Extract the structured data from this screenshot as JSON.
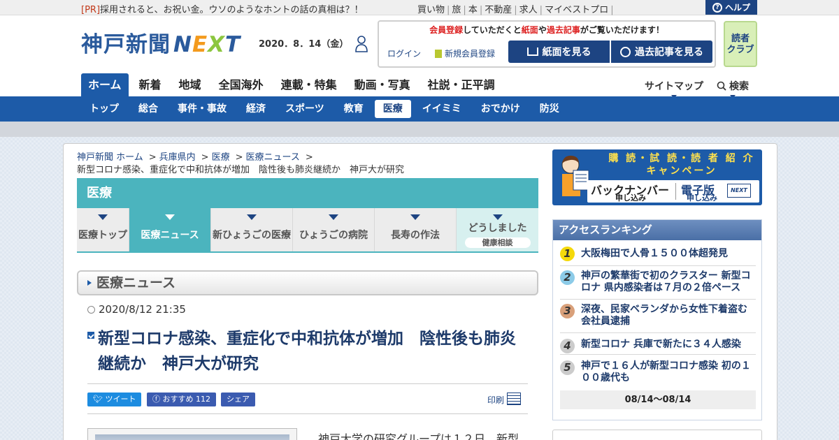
{
  "topbar": {
    "pr_tag": "[PR]",
    "pr_text": "採用されると、お祝い金。ウソのようなホントの話の真相は？！",
    "util_links": [
      "買い物",
      "旅",
      "本",
      "不動産",
      "求人",
      "マイベストプロ"
    ],
    "help_label": "ヘルプ"
  },
  "header": {
    "logo_text": "神戸新聞",
    "logo_next": [
      "N",
      "E",
      "X",
      "T"
    ],
    "date": "2020．8．14（金）",
    "member_msg": {
      "p1": "会員登録",
      "p2": "していただくと",
      "p3": "紙面",
      "p4": "や",
      "p5": "過去記事",
      "p6": "がご覧いただけます！"
    },
    "login_label": "ログイン",
    "register_label": "新規会員登録",
    "view_paper_label": "紙面を見る",
    "past_articles_label": "過去記事を見る",
    "club_line1": "読者",
    "club_line2": "クラブ"
  },
  "main_nav": [
    "ホーム",
    "新着",
    "地域",
    "全国海外",
    "連載・特集",
    "動画・写真",
    "社説・正平調"
  ],
  "right_nav": {
    "sitemap": "サイトマップ",
    "search": "検索"
  },
  "sub_nav": [
    "トップ",
    "総合",
    "事件・事故",
    "経済",
    "スポーツ",
    "教育",
    "医療",
    "イイミミ",
    "おでかけ",
    "防災"
  ],
  "breadcrumb": {
    "items": [
      "神戸新聞 ホーム",
      "兵庫県内",
      "医療",
      "医療ニュース"
    ],
    "current": "新型コロナ感染、重症化で中和抗体が増加　陰性後も肺炎継続か　神戸大が研究"
  },
  "section": {
    "title": "医療",
    "tabs": [
      "医療トップ",
      "医療ニュース",
      "新ひょうごの医療",
      "ひょうごの病院",
      "長寿の作法",
      "どうしました"
    ],
    "tab_pill": "健康相談",
    "news_header": "医療ニュース"
  },
  "article": {
    "datetime": "2020/8/12 21:35",
    "title": "新型コロナ感染、重症化で中和抗体が増加　陰性後も肺炎継続か　神戸大が研究",
    "tweet_label": "ツイート",
    "recommend_label": "おすすめ",
    "recommend_count": "112",
    "share_label": "シェア",
    "print_label": "印刷",
    "lead": "神戸大学の研究グループは１２日、新型"
  },
  "sidebar": {
    "banner": {
      "line1": "購 読・試 読・読 者 紹 介",
      "line2": "キャンペーン",
      "backnumber": "バックナンバー",
      "backnumber_sub": "申し込み",
      "eedition": "電子版",
      "eedition_sub": "申し込み",
      "next_badge": "NEXT"
    },
    "ranking": {
      "title": "アクセスランキング",
      "items": [
        {
          "rank": "1",
          "title": "大阪梅田で人骨１５００体超発見"
        },
        {
          "rank": "2",
          "title": "神戸の繁華街で初のクラスター 新型コロナ 県内感染者は７月の２倍ペース"
        },
        {
          "rank": "3",
          "title": "深夜、民家ベランダから女性下着盗む 会社員逮捕"
        },
        {
          "rank": "4",
          "title": "新型コロナ 兵庫で新たに３４人感染"
        },
        {
          "rank": "5",
          "title": "神戸で１６人が新型コロナ感染 初の１００歳代も"
        }
      ],
      "period": "08/14～08/14"
    }
  },
  "colors": {
    "brand_blue": "#1d5ba8",
    "teal": "#4bb4be",
    "rank1": "#f5d90b",
    "rank2": "#8ccbe8",
    "rank3": "#d9a07a",
    "rank_other": "#cccccc"
  }
}
